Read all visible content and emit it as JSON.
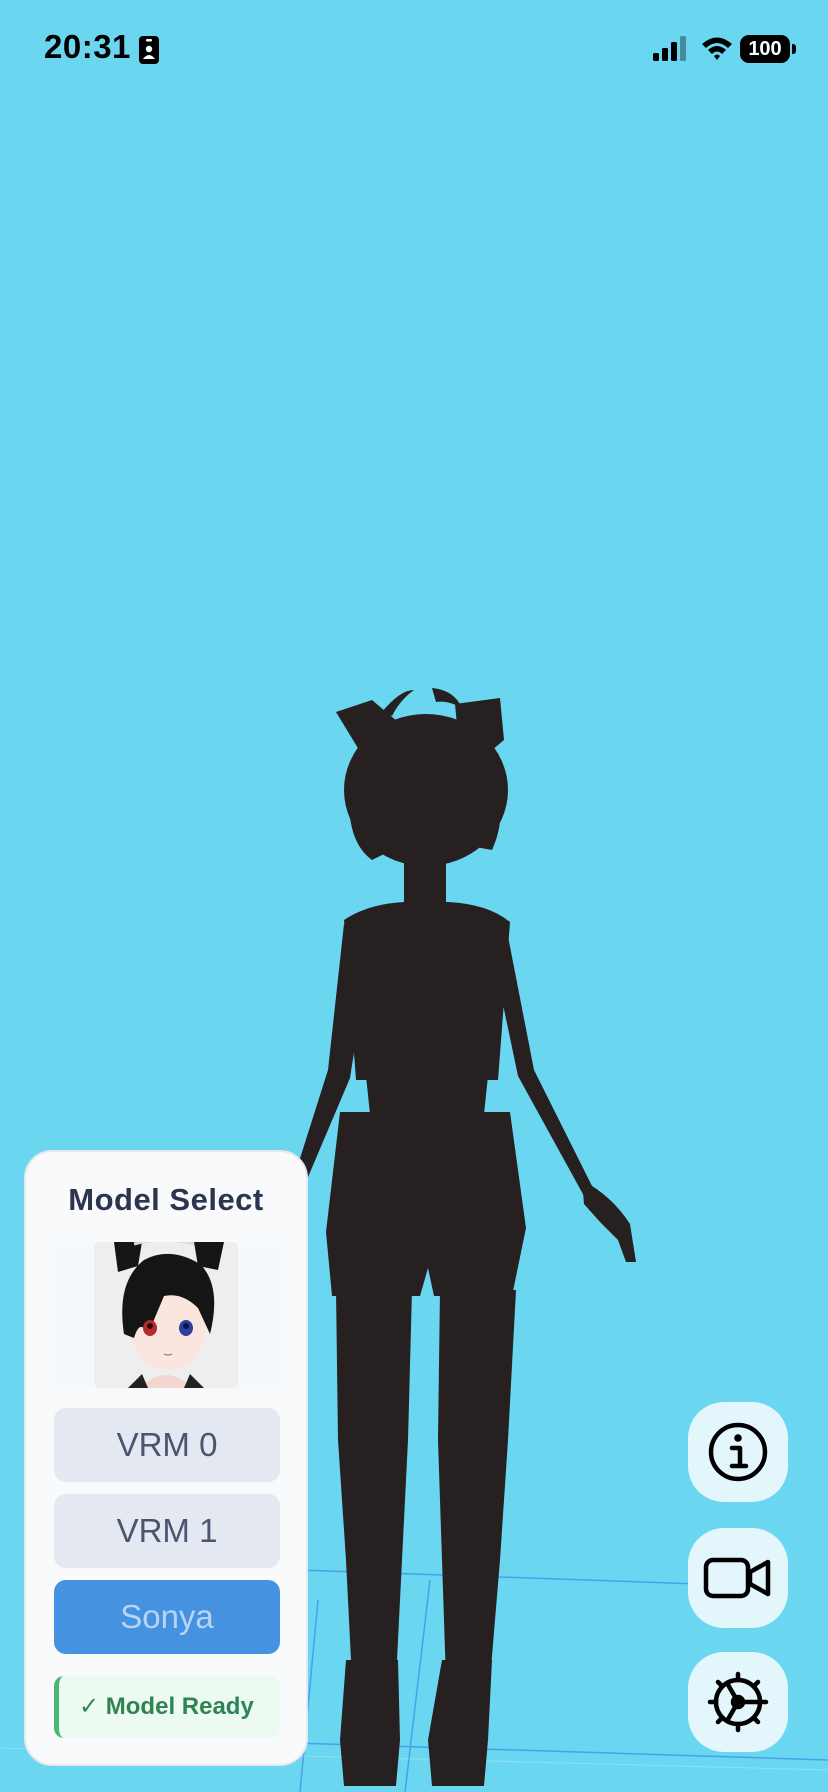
{
  "status_bar": {
    "time": "20:31",
    "battery": "100",
    "icons": [
      "id-card-icon",
      "cellular-signal-icon",
      "wifi-icon",
      "battery-icon"
    ]
  },
  "scene": {
    "background_color": "#6ad6f0",
    "avatar_color": "#262021"
  },
  "model_select": {
    "title": "Model Select",
    "buttons": [
      {
        "label": "VRM 0",
        "active": false
      },
      {
        "label": "VRM 1",
        "active": false
      },
      {
        "label": "Sonya",
        "active": true
      }
    ],
    "status": "✓ Model Ready",
    "colors": {
      "active_button": "#4593e0",
      "inactive_button": "#e4e9f1",
      "status_green": "#2f8552"
    }
  },
  "controls": {
    "icons": [
      "info-icon",
      "video-camera-icon",
      "settings-gear-icon"
    ]
  }
}
